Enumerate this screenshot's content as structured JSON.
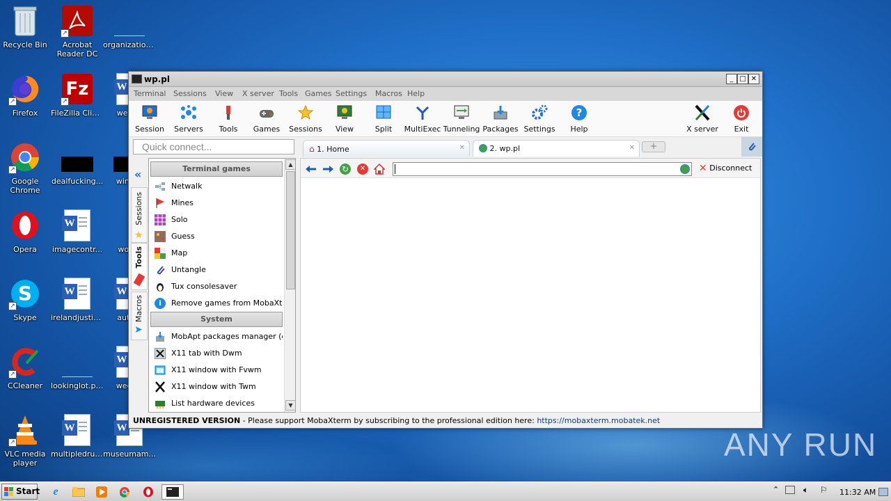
{
  "desktop": {
    "icons": [
      {
        "label": "Recycle Bin"
      },
      {
        "label": "Acrobat Reader DC"
      },
      {
        "label": "organization..."
      },
      {
        "label": "Firefox"
      },
      {
        "label": "FileZilla Client"
      },
      {
        "label": "weann"
      },
      {
        "label": "Google Chrome"
      },
      {
        "label": "dealfucking..."
      },
      {
        "label": "winexe"
      },
      {
        "label": "Opera"
      },
      {
        "label": "imagecontr..."
      },
      {
        "label": "woma"
      },
      {
        "label": "Skype"
      },
      {
        "label": "irelandjustic..."
      },
      {
        "label": "autom"
      },
      {
        "label": "CCleaner"
      },
      {
        "label": "lookinglot.png"
      },
      {
        "label": "weekly"
      },
      {
        "label": "VLC media player"
      },
      {
        "label": "multipledrug..."
      },
      {
        "label": "museumam..."
      }
    ]
  },
  "window": {
    "title": "wp.pl",
    "menu": [
      "Terminal",
      "Sessions",
      "View",
      "X server",
      "Tools",
      "Games",
      "Settings",
      "Macros",
      "Help"
    ],
    "toolbar": [
      {
        "label": "Session",
        "icon": "session-icon"
      },
      {
        "label": "Servers",
        "icon": "servers-icon"
      },
      {
        "label": "Tools",
        "icon": "tools-icon"
      },
      {
        "label": "Games",
        "icon": "games-icon"
      },
      {
        "label": "Sessions",
        "icon": "sessions-star-icon"
      },
      {
        "label": "View",
        "icon": "view-icon"
      },
      {
        "label": "Split",
        "icon": "split-icon"
      },
      {
        "label": "MultiExec",
        "icon": "multiexec-icon"
      },
      {
        "label": "Tunneling",
        "icon": "tunneling-icon"
      },
      {
        "label": "Packages",
        "icon": "packages-icon"
      },
      {
        "label": "Settings",
        "icon": "settings-gear-icon"
      },
      {
        "label": "Help",
        "icon": "help-icon"
      },
      {
        "label": "X server",
        "icon": "xserver-icon"
      },
      {
        "label": "Exit",
        "icon": "power-icon"
      }
    ],
    "quick_connect_placeholder": "Quick connect...",
    "tabs": [
      {
        "label": "1. Home",
        "icon": "home-icon"
      },
      {
        "label": "2. wp.pl",
        "icon": "globe-icon"
      }
    ],
    "side_tabs": [
      "Sessions",
      "Tools",
      "Macros"
    ],
    "panel": {
      "section1": "Terminal games",
      "games": [
        "Netwalk",
        "Mines",
        "Solo",
        "Guess",
        "Map",
        "Untangle",
        "Tux consolesaver",
        "Remove games from MobaXterm"
      ],
      "section2": "System",
      "system": [
        "MobApt packages manager (expe",
        "X11 tab with Dwm",
        "X11 window with Fvwm",
        "X11 window with Twm",
        "List hardware devices"
      ]
    },
    "browser": {
      "url": "",
      "disconnect_label": "Disconnect"
    },
    "status": {
      "bold": "UNREGISTERED VERSION",
      "text": " -  Please support MobaXterm by subscribing to the professional edition here: ",
      "link": "https://mobaxterm.mobatek.net"
    }
  },
  "taskbar": {
    "start_label": "Start",
    "clock": "11:32 AM"
  },
  "watermark": "ANY RUN"
}
